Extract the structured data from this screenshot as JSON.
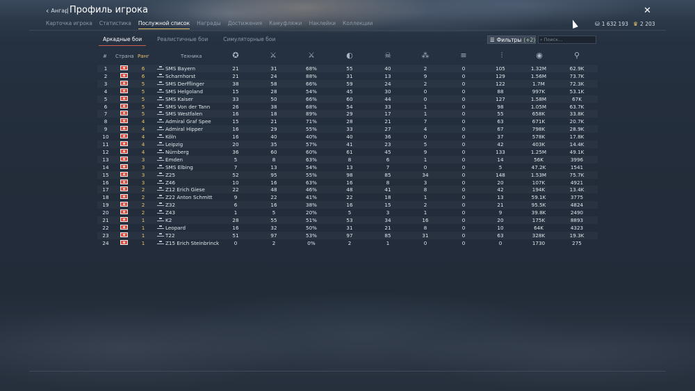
{
  "header": {
    "back_label": "Ангар",
    "separator": "|",
    "title": "Профиль игрока",
    "close": "✕",
    "silver": "1 632 193",
    "gold": "2 203"
  },
  "tabs": [
    {
      "label": "Карточка игрока",
      "active": false
    },
    {
      "label": "Статистика",
      "active": false
    },
    {
      "label": "Послужной список",
      "active": true
    },
    {
      "label": "Награды",
      "active": false
    },
    {
      "label": "Достижения",
      "active": false
    },
    {
      "label": "Камуфляжи",
      "active": false
    },
    {
      "label": "Наклейки",
      "active": false
    },
    {
      "label": "Коллекции",
      "active": false
    }
  ],
  "mode_tabs": [
    {
      "label": "Аркадные бои",
      "active": true
    },
    {
      "label": "Реалистичные бои",
      "active": false
    },
    {
      "label": "Симуляторные бои",
      "active": false
    }
  ],
  "filters": {
    "label": "Фильтры",
    "count": "(+2)"
  },
  "search": {
    "placeholder": "Поиск..."
  },
  "columns": {
    "num": "#",
    "country": "Страна",
    "rank": "Ранг",
    "vehicle": "Техника",
    "icons": [
      "battles-icon",
      "victories-icon",
      "win-rate-icon",
      "respawns-icon",
      "deaths-icon",
      "air-kills-icon",
      "ground-kills-icon",
      "naval-kills-icon",
      "experience-icon",
      "earnings-icon"
    ]
  },
  "accent_colors": {
    "rank": "#e8c56a",
    "active_tab": "#e8c56a",
    "active_mode": "#d55b4a",
    "flag": "#d94a3c"
  },
  "rows": [
    {
      "n": "1",
      "rank": "6",
      "name": "SMS Bayern",
      "v": [
        "21",
        "31",
        "68%",
        "55",
        "40",
        "2",
        "0",
        "105",
        "1.32M",
        "62.9K"
      ]
    },
    {
      "n": "2",
      "rank": "6",
      "name": "Scharnhorst",
      "v": [
        "21",
        "24",
        "88%",
        "31",
        "13",
        "9",
        "0",
        "129",
        "1.56M",
        "73.7K"
      ]
    },
    {
      "n": "3",
      "rank": "5",
      "name": "SMS Derfflinger",
      "v": [
        "38",
        "58",
        "66%",
        "59",
        "24",
        "2",
        "0",
        "122",
        "1.7M",
        "72.3K"
      ]
    },
    {
      "n": "4",
      "rank": "5",
      "name": "SMS Helgoland",
      "v": [
        "15",
        "28",
        "54%",
        "45",
        "30",
        "0",
        "0",
        "88",
        "997K",
        "53.1K"
      ]
    },
    {
      "n": "5",
      "rank": "5",
      "name": "SMS Kaiser",
      "v": [
        "33",
        "50",
        "66%",
        "60",
        "44",
        "0",
        "0",
        "127",
        "1.58M",
        "67K"
      ]
    },
    {
      "n": "6",
      "rank": "5",
      "name": "SMS Von der Tann",
      "v": [
        "26",
        "38",
        "68%",
        "54",
        "33",
        "1",
        "0",
        "98",
        "1.05M",
        "63.7K"
      ]
    },
    {
      "n": "7",
      "rank": "5",
      "name": "SMS Westfalen",
      "v": [
        "16",
        "18",
        "89%",
        "29",
        "17",
        "1",
        "0",
        "55",
        "658K",
        "33.8K"
      ]
    },
    {
      "n": "8",
      "rank": "4",
      "name": "Admiral Graf Spee",
      "v": [
        "15",
        "21",
        "71%",
        "28",
        "21",
        "7",
        "0",
        "63",
        "671K",
        "20.7K"
      ]
    },
    {
      "n": "9",
      "rank": "4",
      "name": "Admiral Hipper",
      "v": [
        "16",
        "29",
        "55%",
        "33",
        "27",
        "4",
        "0",
        "67",
        "798K",
        "28.9K"
      ]
    },
    {
      "n": "10",
      "rank": "4",
      "name": "Köln",
      "v": [
        "16",
        "40",
        "40%",
        "40",
        "36",
        "0",
        "0",
        "37",
        "578K",
        "17.8K"
      ]
    },
    {
      "n": "11",
      "rank": "4",
      "name": "Leipzig",
      "v": [
        "20",
        "35",
        "57%",
        "41",
        "23",
        "5",
        "0",
        "42",
        "403K",
        "14.4K"
      ]
    },
    {
      "n": "12",
      "rank": "4",
      "name": "Nürnberg",
      "v": [
        "36",
        "60",
        "60%",
        "61",
        "45",
        "9",
        "0",
        "133",
        "1.25M",
        "49.1K"
      ]
    },
    {
      "n": "13",
      "rank": "3",
      "name": "Emden",
      "v": [
        "5",
        "8",
        "63%",
        "8",
        "6",
        "1",
        "0",
        "14",
        "56K",
        "3996"
      ]
    },
    {
      "n": "14",
      "rank": "3",
      "name": "SMS Elbing",
      "v": [
        "7",
        "13",
        "54%",
        "13",
        "7",
        "0",
        "0",
        "5",
        "47.2K",
        "1541"
      ]
    },
    {
      "n": "15",
      "rank": "3",
      "name": "Z25",
      "v": [
        "52",
        "95",
        "55%",
        "98",
        "85",
        "34",
        "0",
        "148",
        "1.53M",
        "75.7K"
      ]
    },
    {
      "n": "16",
      "rank": "3",
      "name": "Z46",
      "v": [
        "10",
        "16",
        "63%",
        "16",
        "8",
        "3",
        "0",
        "20",
        "107K",
        "4921"
      ]
    },
    {
      "n": "17",
      "rank": "2",
      "name": "Z12 Erich Giese",
      "v": [
        "22",
        "48",
        "46%",
        "48",
        "41",
        "8",
        "0",
        "42",
        "194K",
        "13.4K"
      ]
    },
    {
      "n": "18",
      "rank": "2",
      "name": "Z22 Anton Schmitt",
      "v": [
        "9",
        "22",
        "41%",
        "22",
        "18",
        "1",
        "0",
        "13",
        "59.1K",
        "3775"
      ]
    },
    {
      "n": "19",
      "rank": "2",
      "name": "Z32",
      "v": [
        "6",
        "16",
        "38%",
        "16",
        "15",
        "2",
        "0",
        "21",
        "95.5K",
        "4824"
      ]
    },
    {
      "n": "20",
      "rank": "2",
      "name": "Z43",
      "v": [
        "1",
        "5",
        "20%",
        "5",
        "3",
        "1",
        "0",
        "9",
        "39.8K",
        "2490"
      ]
    },
    {
      "n": "21",
      "rank": "1",
      "name": "K2",
      "v": [
        "28",
        "55",
        "51%",
        "53",
        "34",
        "16",
        "0",
        "20",
        "175K",
        "8893"
      ]
    },
    {
      "n": "22",
      "rank": "1",
      "name": "Leopard",
      "v": [
        "16",
        "32",
        "50%",
        "31",
        "21",
        "8",
        "0",
        "10",
        "64K",
        "4323"
      ]
    },
    {
      "n": "23",
      "rank": "1",
      "name": "T22",
      "v": [
        "51",
        "97",
        "53%",
        "97",
        "85",
        "31",
        "0",
        "63",
        "328K",
        "19.3K"
      ]
    },
    {
      "n": "24",
      "rank": "1",
      "name": "Z15 Erich Steinbrinck",
      "v": [
        "0",
        "2",
        "0%",
        "2",
        "1",
        "0",
        "0",
        "0",
        "1730",
        "275"
      ]
    }
  ]
}
